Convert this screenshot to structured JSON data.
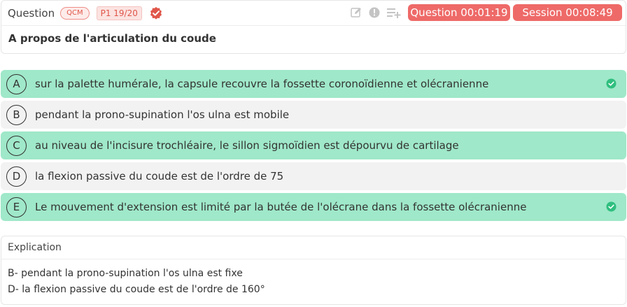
{
  "header": {
    "question_label": "Question",
    "type_badge": "QCM",
    "page_badge": "P1 19/20",
    "timer_question": "Question 00:01:19",
    "timer_session": "Session 00:08:49",
    "icons": [
      "edit-icon",
      "info-icon",
      "add-to-list-icon"
    ]
  },
  "question": {
    "title": "A propos de l'articulation du coude"
  },
  "answers": [
    {
      "letter": "A",
      "text": "sur la palette humérale, la capsule recouvre la fossette coronoïdienne et olécranienne",
      "status": "correct",
      "checked": true
    },
    {
      "letter": "B",
      "text": "pendant la prono-supination l'os ulna est mobile",
      "status": "incorrect",
      "checked": false
    },
    {
      "letter": "C",
      "text": "au niveau de l'incisure trochléaire, le sillon sigmoïdien est dépourvu de cartilage",
      "status": "correct",
      "checked": false
    },
    {
      "letter": "D",
      "text": "la flexion passive du coude est de l'ordre de 75",
      "status": "incorrect",
      "checked": false
    },
    {
      "letter": "E",
      "text": "Le mouvement d'extension est limité par la butée de l'olécrane dans la fossette olécranienne",
      "status": "correct",
      "checked": true
    }
  ],
  "explanation": {
    "title": "Explication",
    "lines": [
      "B- pendant la prono-supination l'os ulna est fixe",
      "D- la flexion passive du coude est de l'ordre de 160°"
    ]
  },
  "colors": {
    "correct_bg": "#9fe8c9",
    "incorrect_bg": "#f2f2f2",
    "timer_bg": "#ee6a68",
    "check_green": "#2fbf7f",
    "badge_red": "#e0564a"
  }
}
